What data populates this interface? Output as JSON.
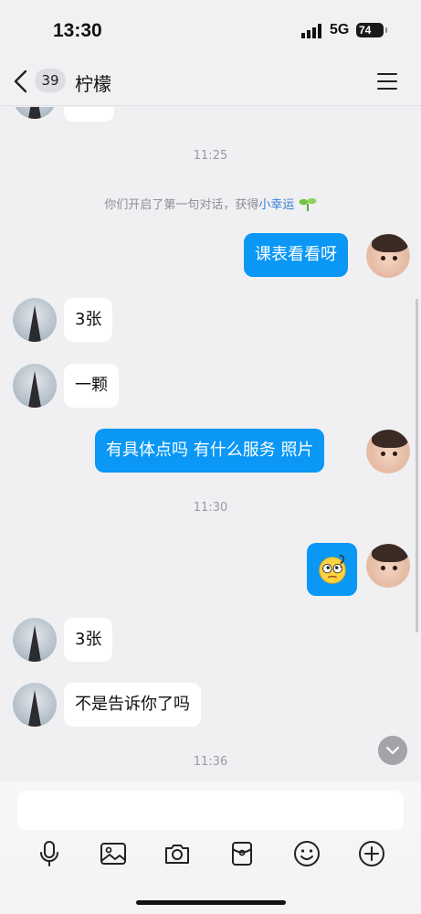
{
  "status_bar": {
    "time": "13:30",
    "network": "5G",
    "battery": "74"
  },
  "header": {
    "unread_count": "39",
    "title": "柠檬"
  },
  "messages": [
    {
      "type": "time",
      "text": "11:25"
    },
    {
      "type": "system",
      "prefix": "你们开启了第一句对话，获得",
      "link": "小幸运"
    },
    {
      "type": "outgoing",
      "text": "课表看看呀"
    },
    {
      "type": "incoming",
      "text": "3张"
    },
    {
      "type": "incoming",
      "text": "一颗"
    },
    {
      "type": "outgoing",
      "text": "有具体点吗  有什么服务  照片"
    },
    {
      "type": "time",
      "text": "11:30"
    },
    {
      "type": "outgoing",
      "sticker": "thinking-emoji"
    },
    {
      "type": "incoming",
      "text": "3张"
    },
    {
      "type": "incoming",
      "text": "不是告诉你了吗"
    },
    {
      "type": "time",
      "text": "11:36"
    }
  ],
  "input": {
    "placeholder": ""
  },
  "toolbar": [
    "microphone-icon",
    "image-icon",
    "camera-icon",
    "red-packet-icon",
    "emoji-icon",
    "plus-icon"
  ],
  "colors": {
    "outgoing_bubble": "#0a97f5",
    "incoming_bubble": "#ffffff",
    "link": "#2f7fd8",
    "background": "#f0f0f2"
  }
}
